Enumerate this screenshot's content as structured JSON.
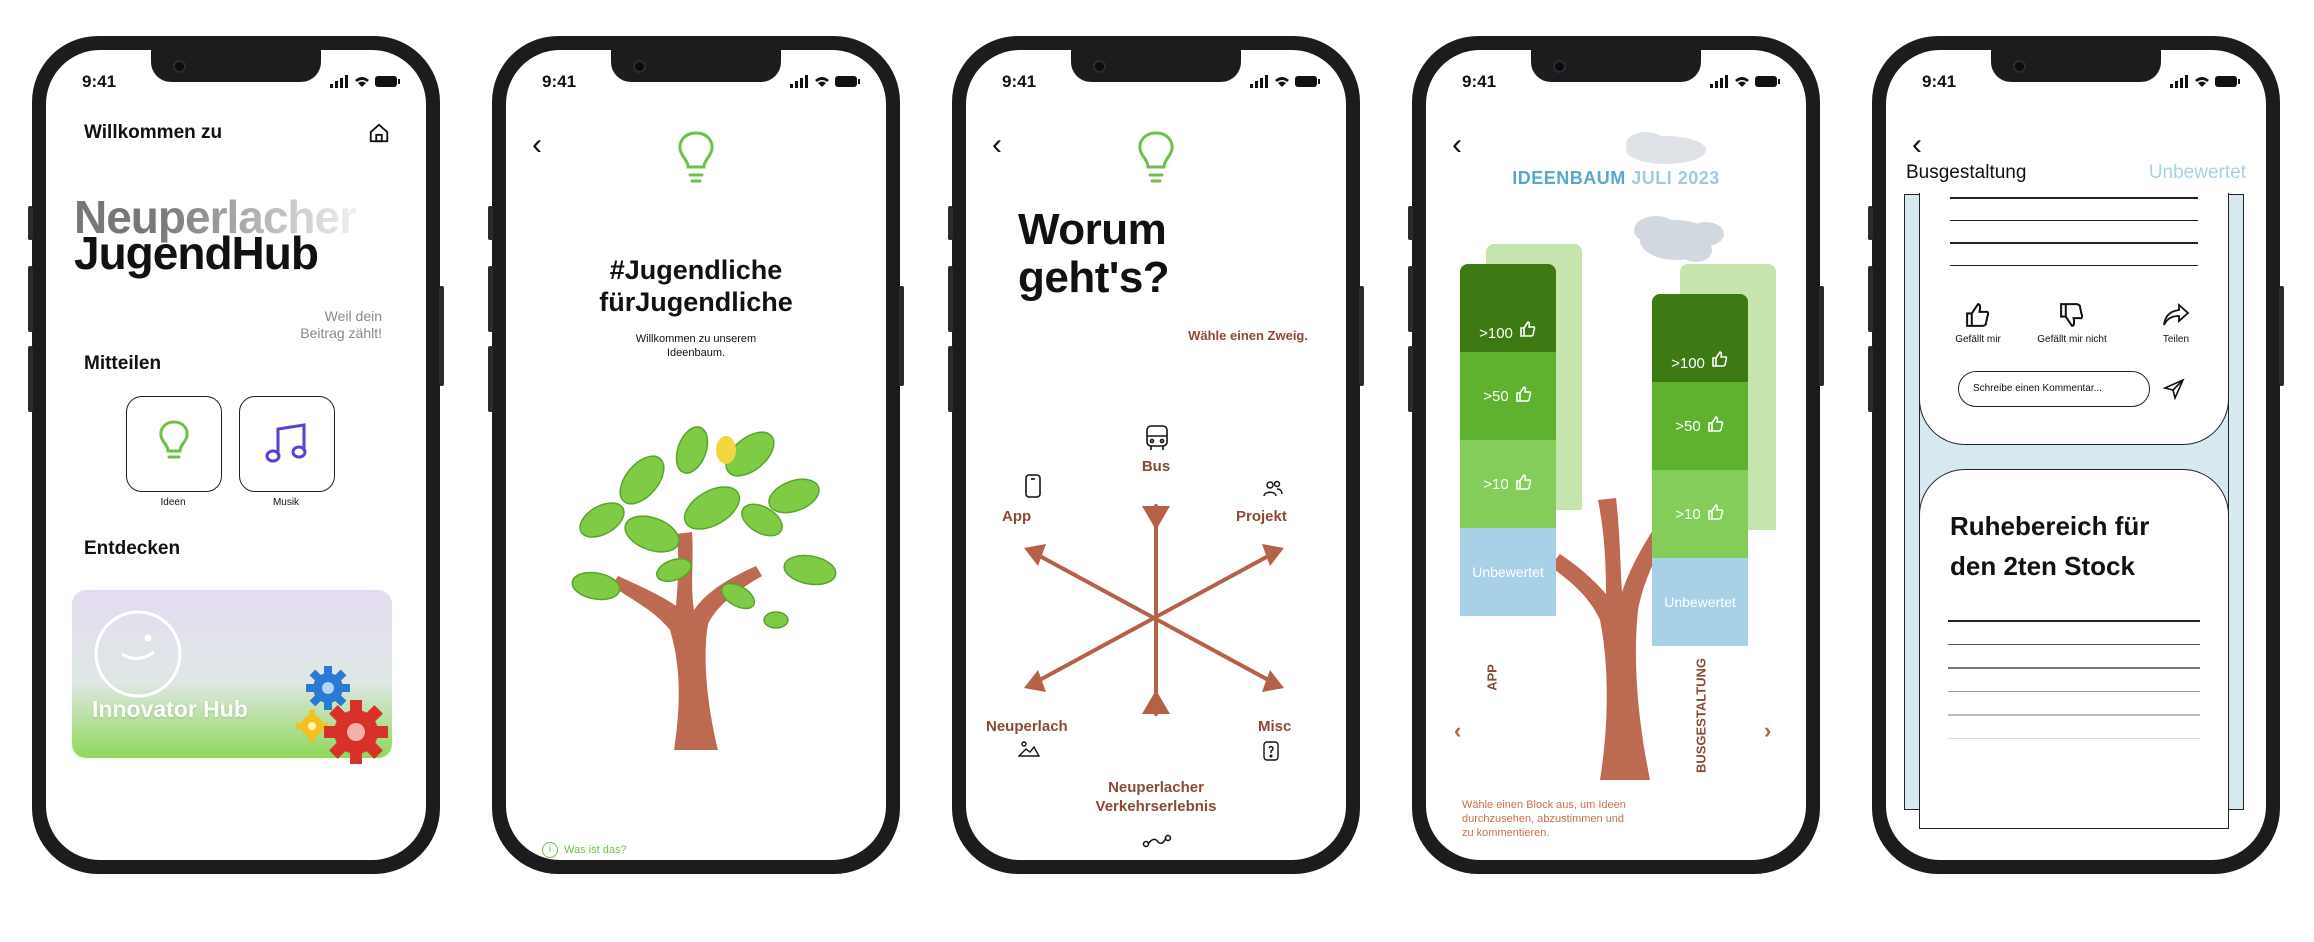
{
  "status": {
    "time": "9:41"
  },
  "screen1": {
    "welcome": "Willkommen zu",
    "title_light": "Neuperlacher",
    "title_bold": "JugendHub",
    "tagline_l1": "Weil dein",
    "tagline_l2": "Beitrag zählt!",
    "section_share": "Mitteilen",
    "tiles": [
      {
        "label": "Ideen",
        "icon": "lightbulb-icon"
      },
      {
        "label": "Musik",
        "icon": "music-note-icon"
      }
    ],
    "section_discover": "Entdecken",
    "card_title": "Innovator Hub"
  },
  "screen2": {
    "heading_l1": "#Jugendliche",
    "heading_l2": "fürJugendliche",
    "sub_l1": "Willkommen zu unserem",
    "sub_l2": "Ideenbaum.",
    "info_link": "Was ist das?"
  },
  "screen3": {
    "heading_l1": "Worum",
    "heading_l2": "geht's?",
    "hint": "Wähle einen Zweig.",
    "branches": {
      "bus": "Bus",
      "app": "App",
      "projekt": "Projekt",
      "neuperlach": "Neuperlach",
      "misc": "Misc",
      "verkehr_l1": "Neuperlacher",
      "verkehr_l2": "Verkehrserlebnis"
    }
  },
  "screen4": {
    "title_bold": "IDEENBAUM",
    "title_light": "JULI 2023",
    "left_column": {
      "label": "APP",
      "blocks": [
        ">100",
        ">50",
        ">10",
        "Unbewertet"
      ]
    },
    "right_column": {
      "label": "BUSGESTALTUNG",
      "blocks": [
        ">100",
        ">50",
        ">10",
        "Unbewertet"
      ]
    },
    "help_l1": "Wähle einen Block aus, um Ideen",
    "help_l2": "durchzusehen, abzustimmen und",
    "help_l3": "zu kommentieren."
  },
  "screen5": {
    "title": "Busgestaltung",
    "status": "Unbewertet",
    "actions": {
      "like": "Gefällt mir",
      "dislike": "Gefällt mir nicht",
      "share": "Teilen"
    },
    "comment_placeholder": "Schreibe einen Kommentar...",
    "card_title_l1": "Ruhebereich für",
    "card_title_l2": "den 2ten Stock"
  },
  "colors": {
    "green": "#6fc04a",
    "brown": "#a8563f",
    "dark_green": "#3a7a14",
    "light_blue": "#d6e9f1"
  }
}
